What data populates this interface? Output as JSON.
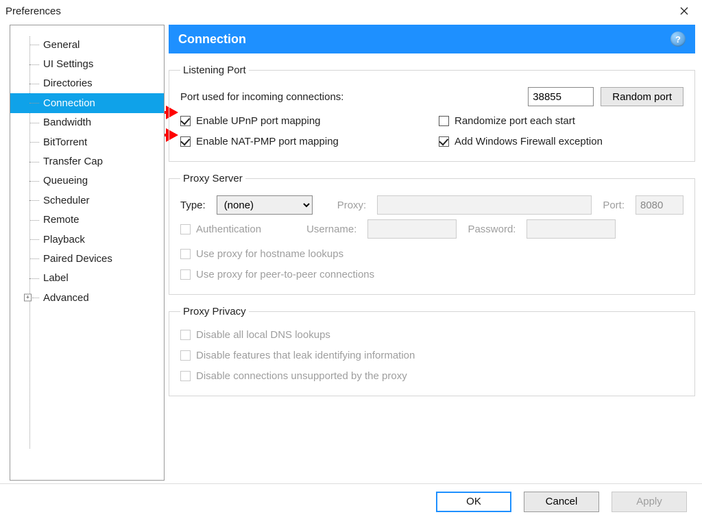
{
  "window": {
    "title": "Preferences"
  },
  "sidebar": {
    "items": [
      {
        "label": "General"
      },
      {
        "label": "UI Settings"
      },
      {
        "label": "Directories"
      },
      {
        "label": "Connection",
        "selected": true
      },
      {
        "label": "Bandwidth"
      },
      {
        "label": "BitTorrent"
      },
      {
        "label": "Transfer Cap"
      },
      {
        "label": "Queueing"
      },
      {
        "label": "Scheduler"
      },
      {
        "label": "Remote"
      },
      {
        "label": "Playback"
      },
      {
        "label": "Paired Devices"
      },
      {
        "label": "Label"
      },
      {
        "label": "Advanced",
        "expandable": true
      }
    ]
  },
  "header": {
    "title": "Connection",
    "help": "?"
  },
  "listening_port": {
    "legend": "Listening Port",
    "port_label": "Port used for incoming connections:",
    "port_value": "38855",
    "random_button": "Random port",
    "upnp_label": "Enable UPnP port mapping",
    "upnp_checked": true,
    "randomize_label": "Randomize port each start",
    "randomize_checked": false,
    "natpmp_label": "Enable NAT-PMP port mapping",
    "natpmp_checked": true,
    "firewall_label": "Add Windows Firewall exception",
    "firewall_checked": true
  },
  "proxy_server": {
    "legend": "Proxy Server",
    "type_label": "Type:",
    "type_value": "(none)",
    "proxy_label": "Proxy:",
    "proxy_value": "",
    "port_label": "Port:",
    "port_value": "8080",
    "auth_label": "Authentication",
    "username_label": "Username:",
    "password_label": "Password:",
    "hostname_label": "Use proxy for hostname lookups",
    "p2p_label": "Use proxy for peer-to-peer connections"
  },
  "proxy_privacy": {
    "legend": "Proxy Privacy",
    "dns_label": "Disable all local DNS lookups",
    "leak_label": "Disable features that leak identifying information",
    "unsupported_label": "Disable connections unsupported by the proxy"
  },
  "buttons": {
    "ok": "OK",
    "cancel": "Cancel",
    "apply": "Apply"
  }
}
